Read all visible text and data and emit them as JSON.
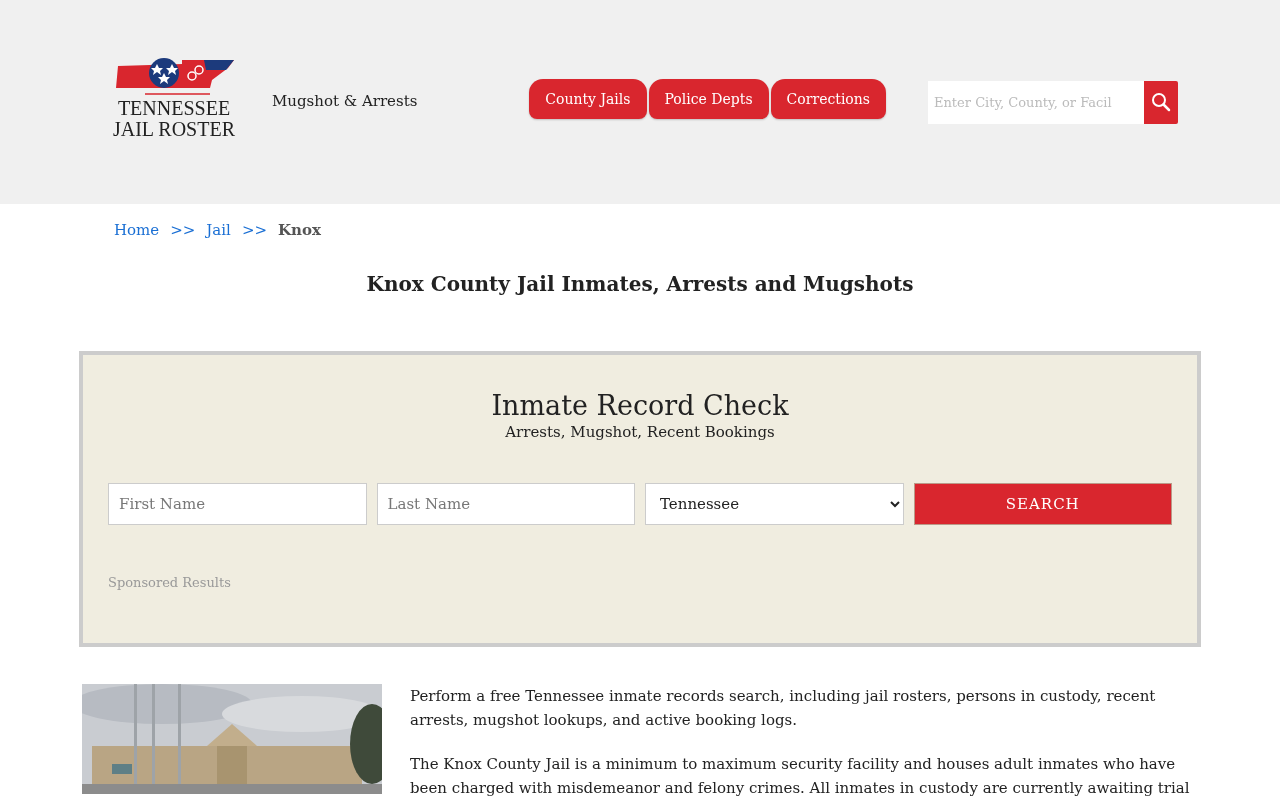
{
  "header": {
    "logo": {
      "line_1": "TENNESSEE",
      "line_2": "JAIL ROSTER"
    },
    "tagline": "Mugshot & Arrests",
    "nav_tabs": [
      {
        "label": "County Jails"
      },
      {
        "label": "Police Depts"
      },
      {
        "label": "Corrections"
      }
    ],
    "search": {
      "placeholder": "Enter City, County, or Facil"
    }
  },
  "breadcrumb": [
    {
      "label": "Home",
      "kind": "link"
    },
    {
      "label": ">>",
      "kind": "separator"
    },
    {
      "label": "Jail",
      "kind": "link"
    },
    {
      "label": ">>",
      "kind": "separator"
    },
    {
      "label": "Knox",
      "kind": "current"
    }
  ],
  "page_title": "Knox County Jail Inmates, Arrests and Mugshots",
  "record_check": {
    "title": "Inmate Record Check",
    "subtitle": "Arrests, Mugshot, Recent Bookings",
    "first_name": {
      "placeholder": "First Name"
    },
    "last_name": {
      "placeholder": "Last Name"
    },
    "state": {
      "value": "Tennessee"
    },
    "search_button": "SEARCH",
    "sponsored": "Sponsored Results"
  },
  "facility_photo": {
    "kind": "picture"
  },
  "paragraphs": [
    "Perform a free Tennessee inmate records search, including jail rosters, persons in custody, recent arrests, mugshot lookups, and active booking logs.",
    "The Knox County Jail is a minimum to maximum security facility and houses adult inmates who have been charged with misdemeanor and felony crimes. All inmates in custody are currently awaiting trial"
  ]
}
